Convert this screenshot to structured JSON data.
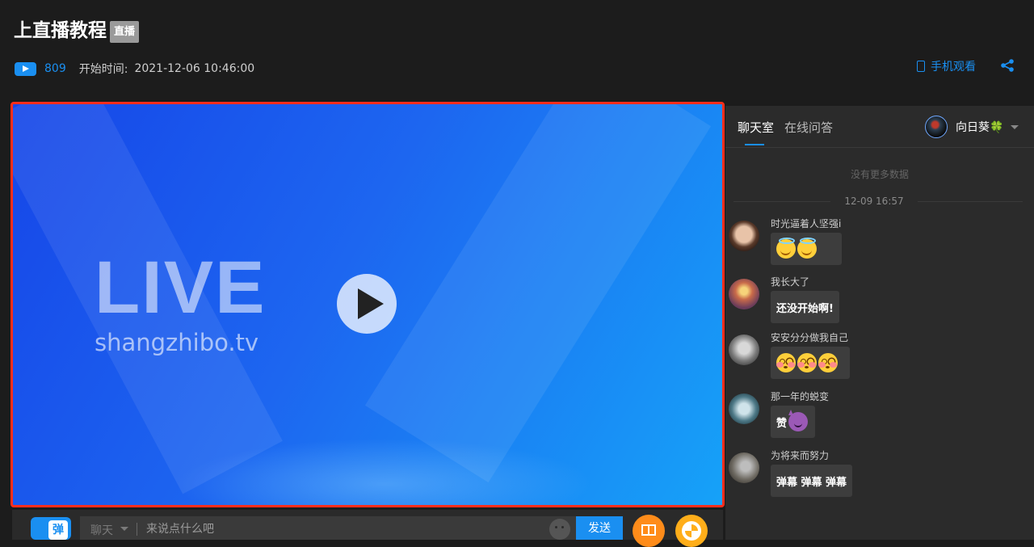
{
  "header": {
    "title": "上直播教程",
    "badge": "直播",
    "view_count": "809",
    "start_label": "开始时间:",
    "start_time": "2021-12-06 10:46:00",
    "mobile_watch": "手机观看"
  },
  "player": {
    "live_text": "LIVE",
    "url_text": "shangzhibo.tv"
  },
  "chatbar": {
    "danmu_label": "弹",
    "chat_type": "聊天",
    "placeholder": "来说点什么吧",
    "send_label": "发送"
  },
  "sidebar": {
    "tabs": [
      {
        "label": "聊天室",
        "active": true
      },
      {
        "label": "在线问答",
        "active": false
      }
    ],
    "user": {
      "name": "向日葵🍀"
    },
    "no_more": "没有更多数据",
    "time_separator": "12-09 16:57",
    "messages": [
      {
        "user": "时光逼着人坚强i",
        "text": "",
        "emojis": [
          "smiling-face-with-halo",
          "smiling-face-with-halo"
        ]
      },
      {
        "user": "我长大了",
        "text": "还没开始啊!",
        "emojis": []
      },
      {
        "user": "安安分分做我自己",
        "text": "",
        "emojis": [
          "flushed-face",
          "flushed-face",
          "flushed-face"
        ]
      },
      {
        "user": "那一年的蜕变",
        "text": "赞",
        "emojis": [
          "smiling-devil"
        ]
      },
      {
        "user": "为将来而努力",
        "text": "弹幕 弹幕 弹幕",
        "emojis": []
      }
    ]
  },
  "colors": {
    "accent": "#1a8ff1",
    "player_border": "#ff2d1b",
    "background": "#1c1c1c",
    "sidebar_bg": "#2b2b2b"
  }
}
